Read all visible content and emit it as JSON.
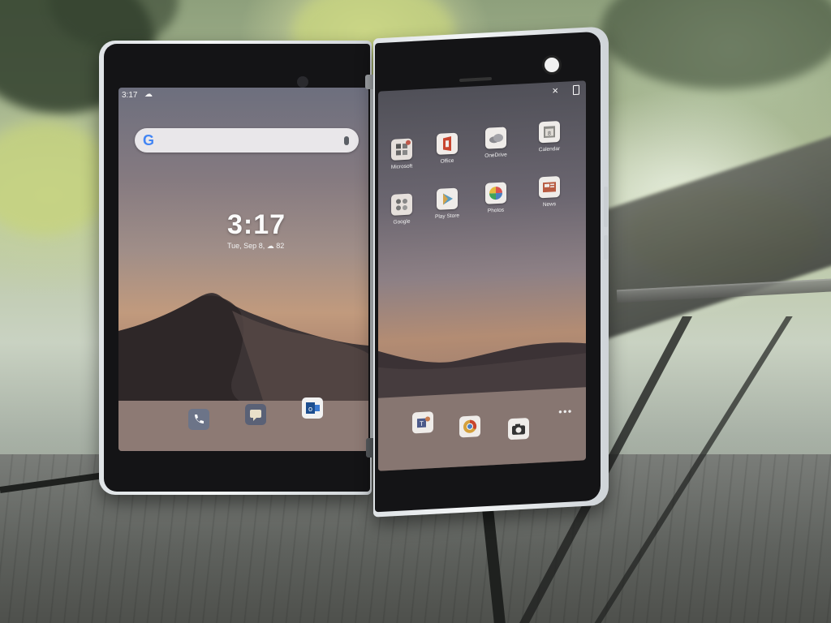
{
  "left_screen": {
    "status_time": "3:17",
    "clock": "3:17",
    "date": "Tue, Sep 8,",
    "temperature": "82",
    "dock": [
      {
        "name": "phone-icon",
        "color": "#6c7488"
      },
      {
        "name": "messages-icon",
        "color": "#5a6176"
      },
      {
        "name": "outlook-icon",
        "color": "#f2f2f2"
      }
    ]
  },
  "right_screen": {
    "apps": [
      {
        "label": "Microsoft",
        "icon": "microsoft-folder-icon"
      },
      {
        "label": "Office",
        "icon": "office-icon"
      },
      {
        "label": "OneDrive",
        "icon": "onedrive-icon"
      },
      {
        "label": "Calendar",
        "icon": "calendar-icon"
      },
      {
        "label": "Google",
        "icon": "google-folder-icon"
      },
      {
        "label": "Play Store",
        "icon": "play-store-icon"
      },
      {
        "label": "Photos",
        "icon": "photos-icon"
      },
      {
        "label": "News",
        "icon": "news-icon"
      }
    ],
    "dock": [
      {
        "name": "teams-icon"
      },
      {
        "name": "chrome-icon"
      },
      {
        "name": "camera-icon"
      }
    ]
  }
}
